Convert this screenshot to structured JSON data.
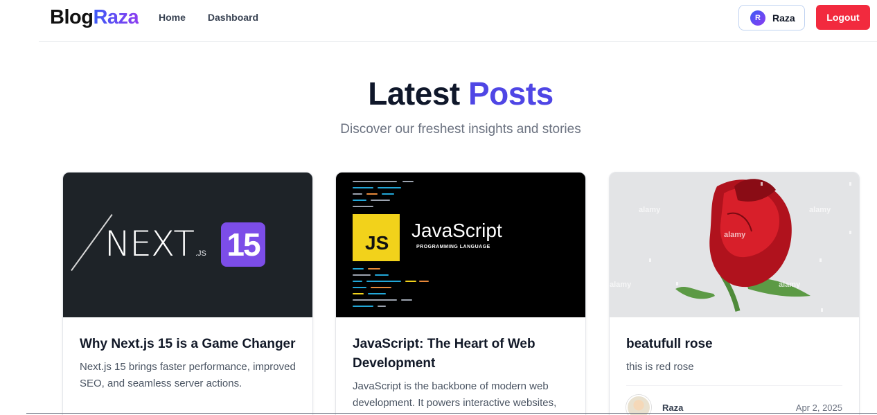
{
  "header": {
    "logo_part1": "Blog",
    "logo_part2": "Raza",
    "nav": [
      {
        "label": "Home"
      },
      {
        "label": "Dashboard"
      }
    ],
    "user": {
      "initial": "R",
      "name": "Raza"
    },
    "logout_label": "Logout"
  },
  "hero": {
    "title_part1": "Latest",
    "title_part2": "Posts",
    "subtitle": "Discover our freshest insights and stories"
  },
  "posts": [
    {
      "title": "Why Next.js 15 is a Game Changer",
      "excerpt": "Next.js 15 brings faster performance, improved SEO, and seamless server actions.",
      "image": {
        "word": "NEXT",
        "suffix": ".JS",
        "badge": "15"
      }
    },
    {
      "title": "JavaScript: The Heart of Web Development",
      "excerpt": "JavaScript is the backbone of modern web development. It powers interactive websites,",
      "image": {
        "badge": "JS",
        "title": "JavaScript",
        "subtitle": "PROGRAMMING LANGUAGE"
      }
    },
    {
      "title": "beatufull rose",
      "excerpt": "this is red rose",
      "author": "Raza",
      "date": "Apr 2, 2025",
      "image": {
        "watermark": "alamy"
      }
    }
  ],
  "colors": {
    "accent": "#4f46e5",
    "logout": "#f22a3e",
    "js_yellow": "#f2d21b",
    "next_badge": "#7c4de8"
  }
}
